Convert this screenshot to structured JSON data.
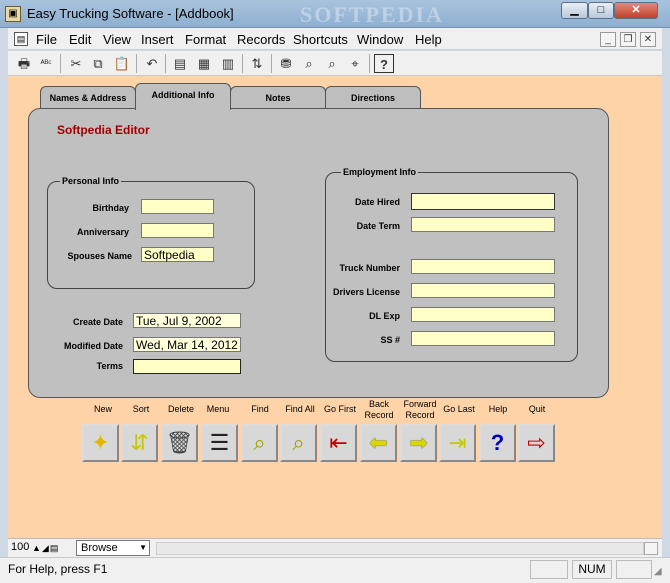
{
  "window": {
    "title": "Easy Trucking Software - [Addbook]",
    "watermark": "SOFTPEDIA"
  },
  "menubar": {
    "items": [
      "File",
      "Edit",
      "View",
      "Insert",
      "Format",
      "Records",
      "Shortcuts",
      "Window",
      "Help"
    ]
  },
  "toolbar": {
    "icons": [
      "print-icon",
      "spellcheck-icon",
      "cut-icon",
      "copy-icon",
      "paste-icon",
      "undo-icon",
      "new-record-icon",
      "copy-record-icon",
      "delete-record-icon",
      "sort-icon",
      "filter-icon",
      "find-icon",
      "find-next-icon",
      "goto-icon",
      "help-icon"
    ]
  },
  "tabs": [
    "Names & Address",
    "Additional Info",
    "Notes",
    "Directions"
  ],
  "editor_title": "Softpedia Editor",
  "personal": {
    "label": "Personal Info",
    "birthday_label": "Birthday",
    "birthday": "",
    "anniversary_label": "Anniversary",
    "anniversary": "",
    "spouse_label": "Spouses Name",
    "spouse": "Softpedia"
  },
  "employment": {
    "label": "Employment Info",
    "hired_label": "Date Hired",
    "hired": "",
    "term_label": "Date Term",
    "term": "",
    "truck_label": "Truck Number",
    "truck": "",
    "license_label": "Drivers License",
    "license": "",
    "dlexp_label": "DL Exp",
    "dlexp": "",
    "ssn_label": "SS #",
    "ssn": ""
  },
  "meta": {
    "create_label": "Create Date",
    "create": "Tue, Jul 9, 2002",
    "modified_label": "Modified Date",
    "modified": "Wed, Mar 14, 2012",
    "terms_label": "Terms",
    "terms": ""
  },
  "buttons": [
    {
      "label": "New",
      "icon": "new-icon",
      "color": "#e0b800"
    },
    {
      "label": "Sort",
      "icon": "sort-icon",
      "color": "#c8c800"
    },
    {
      "label": "Delete",
      "icon": "trash-icon",
      "color": "#444444"
    },
    {
      "label": "Menu",
      "icon": "menu-list-icon",
      "color": "#222222"
    },
    {
      "label": "Find",
      "icon": "find-icon",
      "color": "#c8c800"
    },
    {
      "label": "Find All",
      "icon": "find-all-icon",
      "color": "#c8c800"
    },
    {
      "label": "Go First",
      "icon": "go-first-icon",
      "color": "#c00000"
    },
    {
      "label": "Back Record",
      "icon": "back-arrow-icon",
      "color": "#e8e800"
    },
    {
      "label": "Forward Record",
      "icon": "forward-arrow-icon",
      "color": "#e8e800"
    },
    {
      "label": "Go Last",
      "icon": "go-last-icon",
      "color": "#c8c800"
    },
    {
      "label": "Help",
      "icon": "question-icon",
      "color": "#0000c0"
    },
    {
      "label": "Quit",
      "icon": "exit-door-icon",
      "color": "#c00000"
    }
  ],
  "zoom": {
    "value": "100",
    "mode": "Browse"
  },
  "status": {
    "text": "For Help, press F1",
    "num": "NUM"
  }
}
